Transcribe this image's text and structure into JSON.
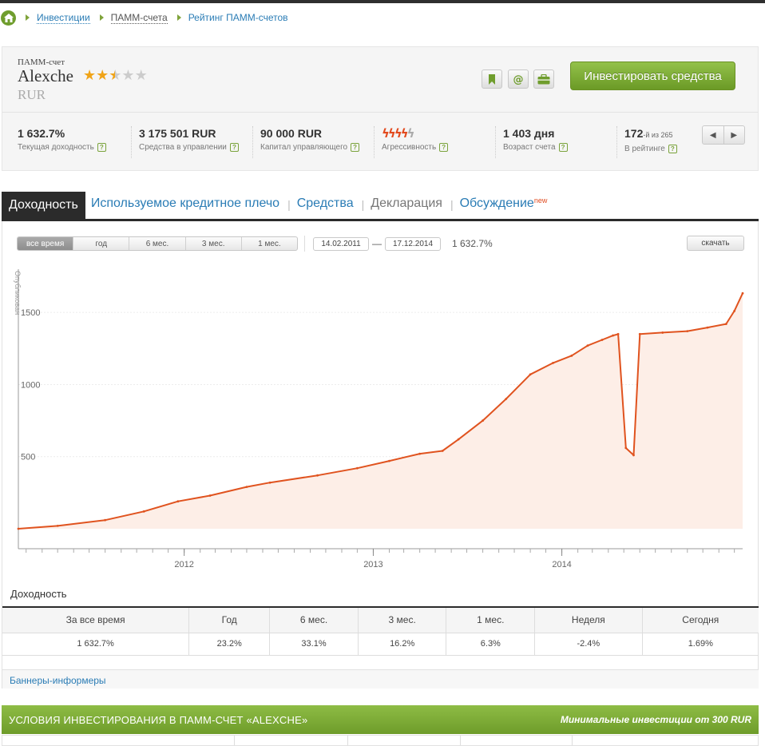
{
  "breadcrumb": {
    "items": [
      "Инвестиции",
      "ПАММ-счета",
      "Рейтинг ПАММ-счетов"
    ]
  },
  "account": {
    "type_label": "ПАММ-счет",
    "name": "Alexche",
    "rating_stars": 2.5,
    "rating_max": 5,
    "currency": "RUR",
    "invest_button": "Инвестировать средства",
    "action_icons": [
      "bookmark-icon",
      "email-icon",
      "briefcase-icon"
    ]
  },
  "stats": [
    {
      "value": "1 632.7%",
      "label": "Текущая доходность"
    },
    {
      "value": "3 175 501 RUR",
      "label": "Средства в управлении"
    },
    {
      "value": "90 000 RUR",
      "label": "Капитал управляющего"
    },
    {
      "value": "",
      "label": "Агрессивность",
      "aggressiveness": 4,
      "aggressiveness_max": 5
    },
    {
      "value": "1 403 дня",
      "label": "Возраст счета"
    },
    {
      "value": "172",
      "value_suffix": "-й из 265",
      "label": "В рейтинге"
    }
  ],
  "tabs": [
    {
      "label": "Доходность",
      "active": true
    },
    {
      "label": "Используемое кредитное плечо"
    },
    {
      "label": "Средства"
    },
    {
      "label": "Декларация"
    },
    {
      "label": "Обсуждение",
      "badge": "new"
    }
  ],
  "chart_controls": {
    "periods": [
      "все время",
      "год",
      "6 мес.",
      "3 мес.",
      "1 мес."
    ],
    "active_period": "все время",
    "date_from": "14.02.2011",
    "date_to": "17.12.2014",
    "range_value": "1 632.7%",
    "download_label": "скачать"
  },
  "chart_data": {
    "type": "area",
    "series": [
      {
        "name": "Доходность",
        "color": "#e0531f",
        "points": [
          [
            "2011-02-14",
            0
          ],
          [
            "2011-05-01",
            20
          ],
          [
            "2011-08-01",
            60
          ],
          [
            "2011-10-15",
            120
          ],
          [
            "2011-12-20",
            190
          ],
          [
            "2012-02-20",
            230
          ],
          [
            "2012-05-01",
            290
          ],
          [
            "2012-06-15",
            320
          ],
          [
            "2012-09-15",
            370
          ],
          [
            "2012-12-01",
            420
          ],
          [
            "2013-02-01",
            470
          ],
          [
            "2013-04-01",
            520
          ],
          [
            "2013-05-15",
            540
          ],
          [
            "2013-06-15",
            620
          ],
          [
            "2013-08-01",
            750
          ],
          [
            "2013-09-15",
            900
          ],
          [
            "2013-11-01",
            1070
          ],
          [
            "2013-12-15",
            1150
          ],
          [
            "2014-01-20",
            1200
          ],
          [
            "2014-02-20",
            1270
          ],
          [
            "2014-03-20",
            1310
          ],
          [
            "2014-04-10",
            1340
          ],
          [
            "2014-04-20",
            1350
          ],
          [
            "2014-05-05",
            560
          ],
          [
            "2014-05-20",
            510
          ],
          [
            "2014-06-01",
            1350
          ],
          [
            "2014-07-15",
            1360
          ],
          [
            "2014-09-01",
            1370
          ],
          [
            "2014-10-10",
            1395
          ],
          [
            "2014-11-15",
            1420
          ],
          [
            "2014-12-01",
            1510
          ],
          [
            "2014-12-17",
            1632.7
          ]
        ]
      }
    ],
    "y_axis_title": "Опубликован",
    "y_ticks": [
      500,
      1000,
      1500
    ],
    "x_ticks": [
      "2012",
      "2013",
      "2014"
    ],
    "ylim": [
      0,
      1800
    ],
    "xlim": [
      "2011-02-14",
      "2014-12-17"
    ],
    "grid": true
  },
  "yield_table": {
    "title": "Доходность",
    "headers": [
      "За все время",
      "Год",
      "6 мес.",
      "3 мес.",
      "1 мес.",
      "Неделя",
      "Сегодня"
    ],
    "values": [
      "1 632.7%",
      "23.2%",
      "33.1%",
      "16.2%",
      "6.3%",
      "-2.4%",
      "1.69%"
    ]
  },
  "banners_link": "Баннеры-информеры",
  "conditions": {
    "title": "УСЛОВИЯ ИНВЕСТИРОВАНИЯ В ПАММ-СЧЕТ «ALEXCHE»",
    "min_investment": "Минимальные инвестиции от 300 RUR"
  }
}
